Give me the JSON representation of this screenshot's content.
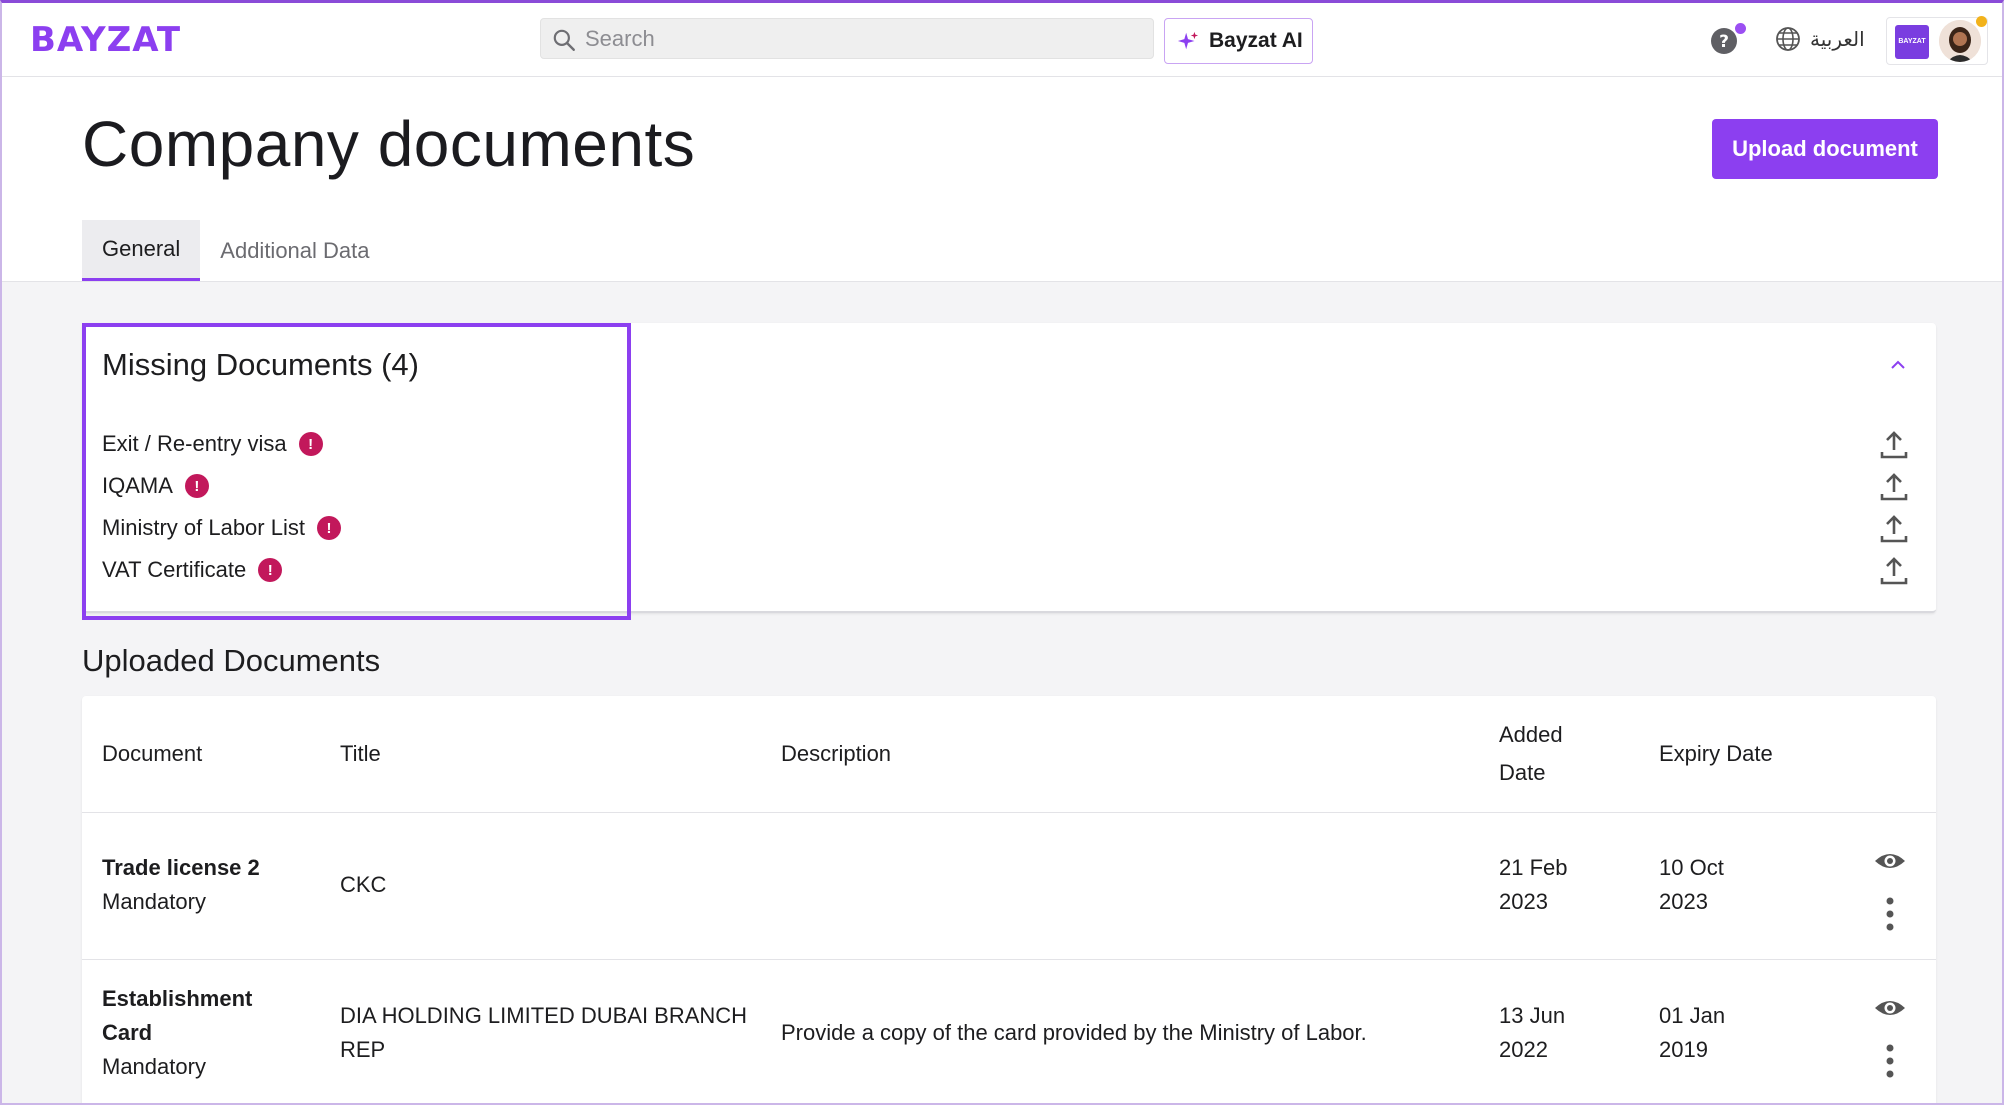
{
  "app": {
    "logo": "BAYZAT",
    "search_placeholder": "Search",
    "ai_label": "Bayzat AI",
    "language": "العربية",
    "company_logo_text": "BAYZAT"
  },
  "page": {
    "title": "Company documents",
    "upload_label": "Upload document",
    "tabs": [
      "General",
      "Additional Data"
    ]
  },
  "missing": {
    "title": "Missing Documents (4)",
    "items": [
      "Exit / Re-entry visa",
      "IQAMA",
      "Ministry of Labor List",
      "VAT Certificate"
    ]
  },
  "uploaded": {
    "title": "Uploaded Documents",
    "columns": {
      "document": "Document",
      "title": "Title",
      "description": "Description",
      "added_line1": "Added",
      "added_line2": "Date",
      "expiry": "Expiry Date"
    },
    "rows": [
      {
        "doc_line1": "Trade license 2",
        "doc_line2": "",
        "status": "Mandatory",
        "title_line1": "CKC",
        "title_line2": "",
        "description": "",
        "added_line1": "21 Feb",
        "added_line2": "2023",
        "expiry_line1": "10 Oct",
        "expiry_line2": "2023"
      },
      {
        "doc_line1": "Establishment",
        "doc_line2": "Card",
        "status": "Mandatory",
        "title_line1": "DIA HOLDING LIMITED DUBAI BRANCH",
        "title_line2": "REP",
        "description": "Provide a copy of the card provided by the Ministry of Labor.",
        "added_line1": "13 Jun",
        "added_line2": "2022",
        "expiry_line1": "01 Jan",
        "expiry_line2": "2019"
      }
    ]
  },
  "colors": {
    "brand": "#8c3ff0",
    "warning": "#c2185b"
  }
}
